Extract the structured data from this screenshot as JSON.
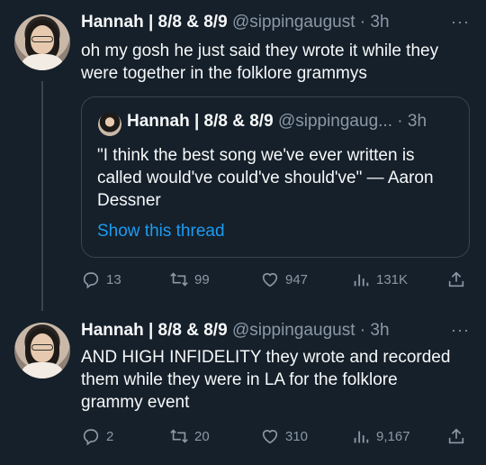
{
  "tweets": [
    {
      "name": "Hannah | 8/8 & 8/9",
      "handle": "@sippingaugust",
      "time": "· 3h",
      "more": "···",
      "text": "oh my gosh he just said they wrote it while they were together in the folklore grammys",
      "quote": {
        "name": "Hannah | 8/8 & 8/9",
        "handle": "@sippingaug...",
        "time": "· 3h",
        "text": "\"I think the best song we've ever written is called would've could've should've\" — Aaron Dessner",
        "show_thread": "Show this thread"
      },
      "stats": {
        "replies": "13",
        "retweets": "99",
        "likes": "947",
        "views": "131K"
      }
    },
    {
      "name": "Hannah | 8/8 & 8/9",
      "handle": "@sippingaugust",
      "time": "· 3h",
      "more": "···",
      "text": "AND HIGH INFIDELITY they wrote and recorded them while they were in LA for the folklore grammy event",
      "stats": {
        "replies": "2",
        "retweets": "20",
        "likes": "310",
        "views": "9,167"
      }
    }
  ],
  "icons": [
    "reply-icon",
    "retweet-icon",
    "like-icon",
    "views-icon",
    "share-icon",
    "more-icon"
  ],
  "colors": {
    "background": "#15202b",
    "text": "#f7f9f9",
    "muted": "#8b98a5",
    "link": "#1d9bf0",
    "border": "#38444d"
  }
}
